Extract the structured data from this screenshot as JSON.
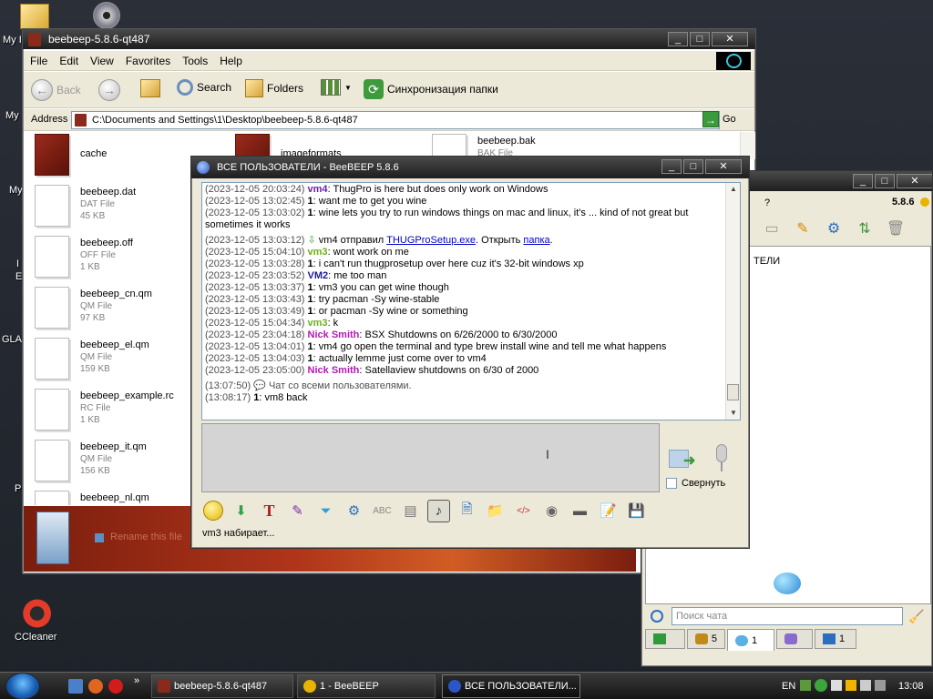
{
  "desktop": {
    "icons": [
      {
        "label": "My I",
        "name": "my-documents"
      },
      {
        "label": "My",
        "name": "my-computer"
      },
      {
        "label": "My",
        "name": "my-network"
      },
      {
        "label": "I",
        "name": "internet-explorer"
      },
      {
        "label": "E",
        "name": "internet-explorer-2"
      },
      {
        "label": "GLA",
        "name": "gla-app"
      },
      {
        "label": "P",
        "name": "p-app"
      },
      {
        "label": "CCleaner",
        "name": "ccleaner"
      }
    ]
  },
  "explorer": {
    "title": "beebeep-5.8.6-qt487",
    "menu": [
      "File",
      "Edit",
      "View",
      "Favorites",
      "Tools",
      "Help"
    ],
    "toolbar": {
      "back": "Back",
      "search": "Search",
      "folders": "Folders",
      "sync": "Синхронизация папки"
    },
    "address_label": "Address",
    "address_value": "C:\\Documents and Settings\\1\\Desktop\\beebeep-5.8.6-qt487",
    "go_label": "Go",
    "files": [
      {
        "name": "cache",
        "type": "",
        "size": "",
        "folder": true
      },
      {
        "name": "imageformats",
        "type": "",
        "size": "",
        "folder": true
      },
      {
        "name": "beebeep.bak",
        "type": "BAK File",
        "size": "",
        "folder": false
      },
      {
        "name": "beebeep.dat",
        "type": "DAT File",
        "size": "45 KB",
        "folder": false
      },
      {
        "name": "beebeep.off",
        "type": "OFF File",
        "size": "1 KB",
        "folder": false
      },
      {
        "name": "beebeep_cn.qm",
        "type": "QM File",
        "size": "97 KB",
        "folder": false
      },
      {
        "name": "beebeep_el.qm",
        "type": "QM File",
        "size": "159 KB",
        "folder": false
      },
      {
        "name": "beebeep_example.rc",
        "type": "RC File",
        "size": "1 KB",
        "folder": false
      },
      {
        "name": "beebeep_it.qm",
        "type": "QM File",
        "size": "156 KB",
        "folder": false
      },
      {
        "name": "beebeep_nl.qm",
        "type": "",
        "size": "",
        "folder": false
      }
    ],
    "rename_task": "Rename this file"
  },
  "chat": {
    "title": "ВСЕ ПОЛЬЗОВАТЕЛИ - BeeBEEP 5.8.6",
    "messages": [
      {
        "ts": "(2023-12-05 20:03:24)",
        "user": "vm4",
        "cls": "u-vm4",
        "text": ": ThugPro is here but does only work on Windows"
      },
      {
        "ts": "(2023-12-05 13:02:45)",
        "user": "1",
        "cls": "u-me",
        "text": ": want me to get you wine"
      },
      {
        "ts": "(2023-12-05 13:03:02)",
        "user": "1",
        "cls": "u-me",
        "text": ": wine lets you try to run windows things on mac and linux, it's ... kind of not great but sometimes it works"
      },
      {
        "ts": "(2023-12-05 13:03:12)",
        "user": "",
        "cls": "",
        "text": " vm4 отправил ",
        "link": "THUGProSetup.exe",
        "text2": ". Открыть ",
        "link2": "папка",
        "text3": ".",
        "gap": true
      },
      {
        "ts": "(2023-12-05 15:04:10)",
        "user": "vm3",
        "cls": "u-vm3",
        "text": ": wont work on me"
      },
      {
        "ts": "(2023-12-05 13:03:28)",
        "user": "1",
        "cls": "u-me",
        "text": ": i can't run thugprosetup over here cuz it's 32-bit windows xp"
      },
      {
        "ts": "(2023-12-05 23:03:52)",
        "user": "VM2",
        "cls": "u-vm2",
        "text": ": me too man"
      },
      {
        "ts": "(2023-12-05 13:03:37)",
        "user": "1",
        "cls": "u-me",
        "text": ": vm3 you can get wine though"
      },
      {
        "ts": "(2023-12-05 13:03:43)",
        "user": "1",
        "cls": "u-me",
        "text": ": try pacman -Sy wine-stable"
      },
      {
        "ts": "(2023-12-05 13:03:49)",
        "user": "1",
        "cls": "u-me",
        "text": ": or pacman -Sy wine or something"
      },
      {
        "ts": "(2023-12-05 15:04:34)",
        "user": "vm3",
        "cls": "u-vm3",
        "text": ": k"
      },
      {
        "ts": "(2023-12-05 23:04:18)",
        "user": "Nick Smith",
        "cls": "u-nick",
        "text": ": BSX Shutdowns on 6/26/2000 to 6/30/2000"
      },
      {
        "ts": "(2023-12-05 13:04:01)",
        "user": "1",
        "cls": "u-me",
        "text": ": vm4 go open the terminal and type brew install wine and tell me what happens"
      },
      {
        "ts": "(2023-12-05 13:04:03)",
        "user": "1",
        "cls": "u-me",
        "text": ": actually lemme just come over to vm4"
      },
      {
        "ts": "(2023-12-05 23:05:00)",
        "user": "Nick Smith",
        "cls": "u-nick",
        "text": ": Satellaview shutdowns on 6/30 of 2000"
      },
      {
        "ts": "(13:07:50)",
        "user": "",
        "cls": "",
        "text": " Чат со всеми пользователями.",
        "sys": true,
        "gap": true
      },
      {
        "ts": "(13:08:17)",
        "user": "1",
        "cls": "u-me",
        "text": ": vm8 back"
      }
    ],
    "collapse_label": "Свернуть",
    "typing_status": "vm3 набирает..."
  },
  "beeright": {
    "version": "5.8.6",
    "menu_q": "?",
    "panel_text": "ТЕЛИ",
    "search_placeholder": "Поиск чата",
    "tabs": [
      {
        "label": "",
        "icon": "home-icon"
      },
      {
        "label": "5",
        "icon": "users-icon"
      },
      {
        "label": "1",
        "icon": "chat-icon"
      },
      {
        "label": "",
        "icon": "groups-icon"
      },
      {
        "label": "1",
        "icon": "file-share-icon"
      }
    ]
  },
  "taskbar": {
    "tasks": [
      {
        "label": "beebeep-5.8.6-qt487",
        "name": "task-explorer"
      },
      {
        "label": "1 - BeeBEEP",
        "name": "task-beebeep"
      },
      {
        "label": "ВСЕ ПОЛЬЗОВАТЕЛИ...",
        "name": "task-all-users"
      }
    ],
    "lang": "EN",
    "clock": "13:08"
  }
}
